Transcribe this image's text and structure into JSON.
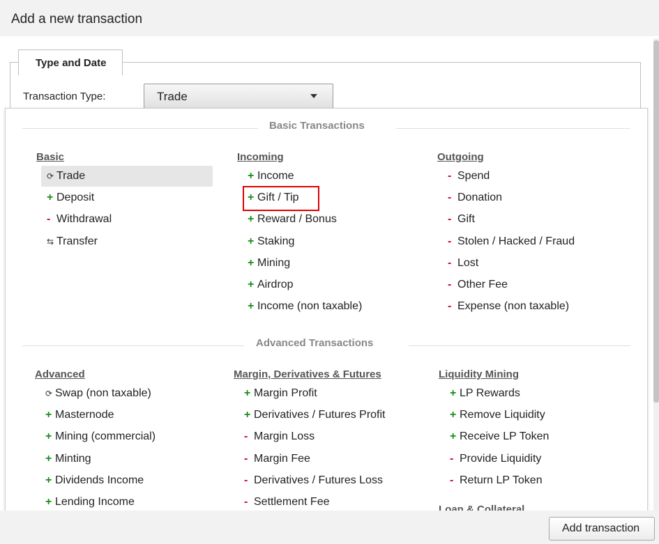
{
  "window": {
    "title": "Add a new transaction"
  },
  "tab": {
    "label": "Type and Date"
  },
  "transaction_type": {
    "label": "Transaction Type:",
    "value": "Trade"
  },
  "basic_section": {
    "title": "Basic Transactions",
    "columns": [
      {
        "heading": "Basic",
        "items": [
          {
            "sym": "⟳",
            "kind": "neutral",
            "label": "Trade"
          },
          {
            "sym": "+",
            "kind": "plus",
            "label": "Deposit"
          },
          {
            "sym": "-",
            "kind": "minus",
            "label": "Withdrawal"
          },
          {
            "sym": "⇆",
            "kind": "neutral",
            "label": "Transfer"
          }
        ]
      },
      {
        "heading": "Incoming",
        "items": [
          {
            "sym": "+",
            "kind": "plus",
            "label": "Income"
          },
          {
            "sym": "+",
            "kind": "plus",
            "label": "Gift / Tip"
          },
          {
            "sym": "+",
            "kind": "plus",
            "label": "Reward / Bonus"
          },
          {
            "sym": "+",
            "kind": "plus",
            "label": "Staking"
          },
          {
            "sym": "+",
            "kind": "plus",
            "label": "Mining"
          },
          {
            "sym": "+",
            "kind": "plus",
            "label": "Airdrop"
          },
          {
            "sym": "+",
            "kind": "plus",
            "label": "Income (non taxable)"
          }
        ]
      },
      {
        "heading": "Outgoing",
        "items": [
          {
            "sym": "-",
            "kind": "minus",
            "label": "Spend"
          },
          {
            "sym": "-",
            "kind": "minus",
            "label": "Donation"
          },
          {
            "sym": "-",
            "kind": "minus",
            "label": "Gift"
          },
          {
            "sym": "-",
            "kind": "minus",
            "label": "Stolen / Hacked / Fraud"
          },
          {
            "sym": "-",
            "kind": "minus",
            "label": "Lost"
          },
          {
            "sym": "-",
            "kind": "minus",
            "label": "Other Fee"
          },
          {
            "sym": "-",
            "kind": "minus",
            "label": "Expense (non taxable)"
          }
        ]
      }
    ]
  },
  "advanced_section": {
    "title": "Advanced Transactions",
    "columns": [
      {
        "heading": "Advanced",
        "items": [
          {
            "sym": "⟳",
            "kind": "neutral",
            "label": "Swap (non taxable)"
          },
          {
            "sym": "+",
            "kind": "plus",
            "label": "Masternode"
          },
          {
            "sym": "+",
            "kind": "plus",
            "label": "Mining (commercial)"
          },
          {
            "sym": "+",
            "kind": "plus",
            "label": "Minting"
          },
          {
            "sym": "+",
            "kind": "plus",
            "label": "Dividends Income"
          },
          {
            "sym": "+",
            "kind": "plus",
            "label": "Lending Income"
          }
        ]
      },
      {
        "heading": "Margin, Derivatives & Futures",
        "items": [
          {
            "sym": "+",
            "kind": "plus",
            "label": "Margin Profit"
          },
          {
            "sym": "+",
            "kind": "plus",
            "label": "Derivatives / Futures Profit"
          },
          {
            "sym": "-",
            "kind": "minus",
            "label": "Margin Loss"
          },
          {
            "sym": "-",
            "kind": "minus",
            "label": "Margin Fee"
          },
          {
            "sym": "-",
            "kind": "minus",
            "label": "Derivatives / Futures Loss"
          },
          {
            "sym": "-",
            "kind": "minus",
            "label": "Settlement Fee"
          }
        ]
      },
      {
        "heading": "Liquidity Mining",
        "items": [
          {
            "sym": "+",
            "kind": "plus",
            "label": "LP Rewards"
          },
          {
            "sym": "+",
            "kind": "plus",
            "label": "Remove Liquidity"
          },
          {
            "sym": "+",
            "kind": "plus",
            "label": "Receive LP Token"
          },
          {
            "sym": "-",
            "kind": "minus",
            "label": "Provide Liquidity"
          },
          {
            "sym": "-",
            "kind": "minus",
            "label": "Return LP Token"
          }
        ]
      }
    ],
    "partial_heading": "Loan & Collateral"
  },
  "footer": {
    "add_button": "Add transaction"
  },
  "colors": {
    "plus": "#1a8c1a",
    "minus": "#d0021b",
    "highlight": "#e00000"
  }
}
